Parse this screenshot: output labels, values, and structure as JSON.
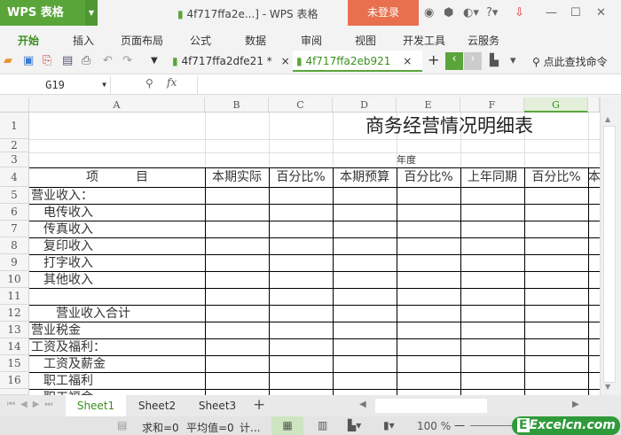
{
  "app": {
    "logo": "WPS 表格",
    "window_title": "4f717ffa2e...] - WPS 表格",
    "login": "未登录"
  },
  "menu": [
    "开始",
    "插入",
    "页面布局",
    "公式",
    "数据",
    "审阅",
    "视图",
    "开发工具",
    "云服务"
  ],
  "doc_tabs": [
    {
      "label": "4f717ffa2dfe21 *"
    },
    {
      "label": "4f717ffa2eb921"
    }
  ],
  "search_cmd": "点此查找命令",
  "formula": {
    "cell_ref": "G19",
    "fx": "fx",
    "value": ""
  },
  "columns": [
    "A",
    "B",
    "C",
    "D",
    "E",
    "F",
    "G"
  ],
  "rows": [
    "1",
    "2",
    "3",
    "4",
    "5",
    "6",
    "7",
    "8",
    "9",
    "10",
    "11",
    "12",
    "13",
    "14",
    "15",
    "16"
  ],
  "sheet": {
    "title": "商务经营情况明细表",
    "year_label": "年度",
    "header": {
      "item": "项　　　目",
      "b": "本期实际",
      "c": "百分比%",
      "d": "本期预算",
      "e": "百分比%",
      "f": "上年同期",
      "g": "百分比%",
      "h": "本"
    },
    "items": [
      "营业收入：",
      "　电传收入",
      "　传真收入",
      "　复印收入",
      "　打字收入",
      "　其他收入",
      "",
      "　　营业收入合计",
      "营业税金",
      "工资及福利：",
      "　工资及薪金",
      "　职工福利",
      "　职工福金"
    ]
  },
  "sheet_tabs": [
    "Sheet1",
    "Sheet2",
    "Sheet3"
  ],
  "status": {
    "sum": "求和=0",
    "avg": "平均值=0",
    "count": "计...",
    "zoom": "100 %"
  },
  "watermark": "Excelcn.com"
}
